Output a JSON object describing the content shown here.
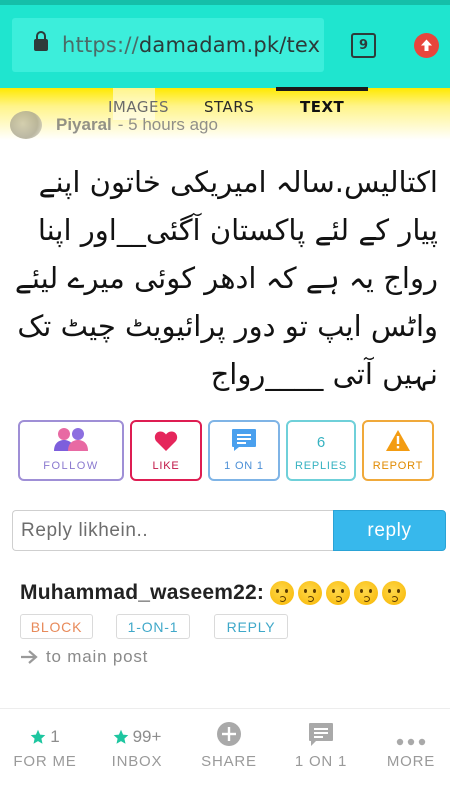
{
  "browser": {
    "url_scheme": "https://",
    "url_host": "damadam.pk/tex",
    "tab_count": "9"
  },
  "site": {
    "tabs": [
      "IMAGES",
      "STARS",
      "TEXT"
    ],
    "active_tab": "TEXT",
    "post_author": "Piyaral",
    "post_time": "- 5 hours ago"
  },
  "post": {
    "text": "اکتالیس.سالہ امیریکی خاتون اپنے پیار کے لئے پاکستان آگئی__اور اپنا رواج یہ ہے کہ ادھر کوئی میرے لیئے واٹس ایپ تو دور پرائیویٹ چیٹ تک نہیں آتی ____رواج"
  },
  "actions": {
    "follow": "FOLLOW",
    "like": "LIKE",
    "one_on_one": "1 ON 1",
    "replies_count": "6",
    "replies": "REPLIES",
    "report": "REPORT"
  },
  "reply_form": {
    "placeholder": "Reply likhein..",
    "button": "reply"
  },
  "reply": {
    "username": "Muhammad_waseem22",
    "colon": ":",
    "emoji_count": 5,
    "block": "BLOCK",
    "one_on_one": "1-ON-1",
    "reply": "REPLY",
    "to_main_post": "to main post"
  },
  "bottom_nav": {
    "forme_count": "1",
    "forme_label": "FOR ME",
    "inbox_count": "99+",
    "inbox_label": "INBOX",
    "share_label": "SHARE",
    "oneonone_label": "1 ON 1",
    "more_label": "MORE"
  },
  "colors": {
    "browser_bar": "#1fe5cf",
    "reply_button": "#37b8ec",
    "like_red": "#de1d52",
    "report_orange": "#f0a93a",
    "nav_star": "#1ec6a0"
  }
}
